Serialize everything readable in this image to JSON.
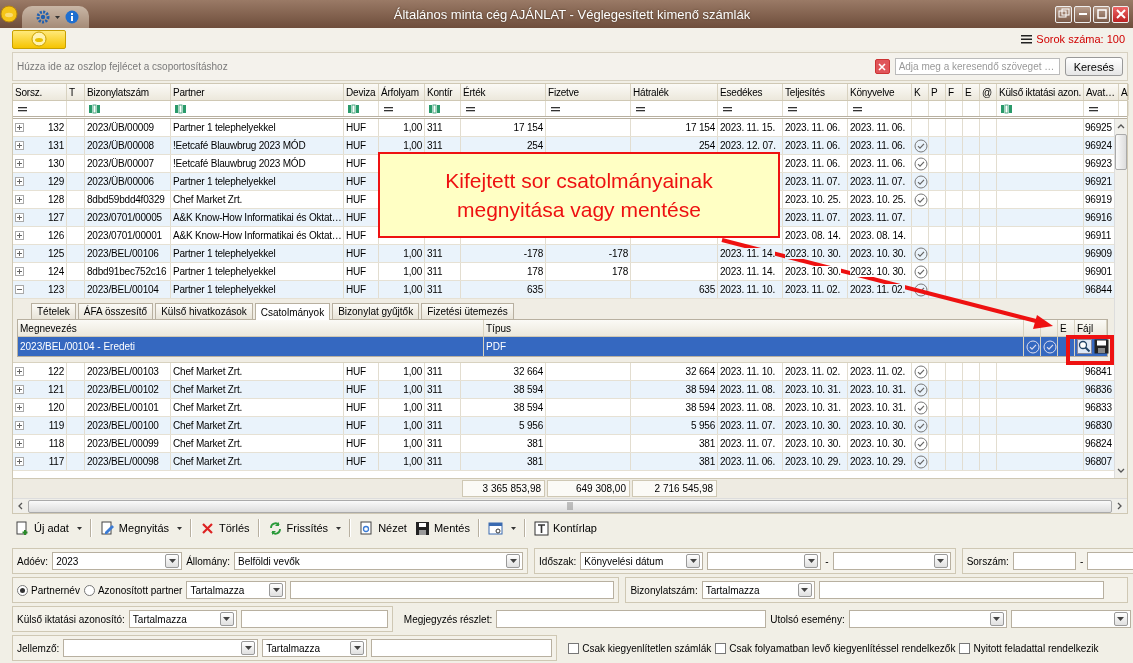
{
  "window": {
    "title": "Általános minta cég AJÁNLAT - Véglegesített kimenő számlák"
  },
  "row_count": "Sorok száma: 100",
  "group_panel": {
    "hint": "Húzza ide az oszlop fejlécet a csoportosításhoz",
    "search": {
      "placeholder": "Adja meg a keresendő szöveget …"
    },
    "search_button": "Keresés"
  },
  "grid": {
    "columns": [
      {
        "label": "Sorsz.",
        "kind": "number"
      },
      {
        "label": "T",
        "kind": "text"
      },
      {
        "label": "Bizonylatszám",
        "kind": "text"
      },
      {
        "label": "Partner",
        "kind": "text"
      },
      {
        "label": "Deviza",
        "kind": "text"
      },
      {
        "label": "Árfolyam",
        "kind": "number"
      },
      {
        "label": "Kontír",
        "kind": "text"
      },
      {
        "label": "Érték",
        "kind": "number"
      },
      {
        "label": "Fizetve",
        "kind": "number"
      },
      {
        "label": "Hátralék",
        "kind": "number"
      },
      {
        "label": "Esedékes",
        "kind": "text"
      },
      {
        "label": "Teljesítés",
        "kind": "text"
      },
      {
        "label": "Könyvelve",
        "kind": "text"
      },
      {
        "label": "K",
        "kind": "check"
      },
      {
        "label": "P",
        "kind": "check"
      },
      {
        "label": "F",
        "kind": "check"
      },
      {
        "label": "E",
        "kind": "check"
      },
      {
        "label": "@",
        "kind": "check"
      },
      {
        "label": "Külső iktatási azon.",
        "kind": "text"
      },
      {
        "label": "Avat…",
        "kind": "text"
      },
      {
        "label": "A"
      }
    ],
    "filter_row": [
      {
        "kind": "equals"
      },
      {
        "kind": "none"
      },
      {
        "kind": "text"
      },
      {
        "kind": "text"
      },
      {
        "kind": "text"
      },
      {
        "kind": "equals"
      },
      {
        "kind": "text"
      },
      {
        "kind": "equals"
      },
      {
        "kind": "equals"
      },
      {
        "kind": "equals"
      },
      {
        "kind": "equals"
      },
      {
        "kind": "equals"
      },
      {
        "kind": "equals"
      },
      {
        "kind": "none"
      },
      {
        "kind": "none"
      },
      {
        "kind": "none"
      },
      {
        "kind": "none"
      },
      {
        "kind": "none"
      },
      {
        "kind": "text"
      },
      {
        "kind": "equals"
      },
      {
        "kind": "none"
      }
    ],
    "rows": [
      {
        "expanded": false,
        "cells": [
          "132",
          null,
          "2023/ÜB/00009",
          "Partner 1 telephelyekkel",
          "HUF",
          "1,00",
          "311",
          "17 154",
          null,
          "17 154",
          "2023. 11. 15.",
          "2023. 11. 06.",
          "2023. 11. 06.",
          false,
          null,
          null,
          null,
          null,
          null,
          "96925"
        ]
      },
      {
        "expanded": false,
        "cells": [
          "131",
          null,
          "2023/ÜB/00008",
          "!Eetcafé Blauwbrug 2023 MÓD",
          "HUF",
          "1,00",
          "311",
          "254",
          null,
          "254",
          "2023. 12. 07.",
          "2023. 11. 06.",
          "2023. 11. 06.",
          true,
          null,
          null,
          null,
          null,
          null,
          "96924"
        ]
      },
      {
        "expanded": false,
        "cells": [
          "130",
          null,
          "2023/ÜB/00007",
          "!Eetcafé Blauwbrug 2023 MÓD",
          "HUF",
          null,
          null,
          null,
          null,
          null,
          null,
          "2023. 11. 06.",
          "2023. 11. 06.",
          true,
          null,
          null,
          null,
          null,
          null,
          "96923"
        ]
      },
      {
        "expanded": false,
        "cells": [
          "129",
          null,
          "2023/ÜB/00006",
          "Partner 1 telephelyekkel",
          "HUF",
          null,
          null,
          null,
          null,
          null,
          null,
          "2023. 11. 07.",
          "2023. 11. 07.",
          true,
          null,
          null,
          null,
          null,
          null,
          "96921"
        ]
      },
      {
        "expanded": false,
        "cells": [
          "128",
          null,
          "8dbd59bdd4f0329",
          "Chef Market Zrt.",
          "HUF",
          null,
          null,
          null,
          null,
          null,
          null,
          "2023. 10. 25.",
          "2023. 10. 25.",
          true,
          null,
          null,
          null,
          null,
          null,
          "96919"
        ]
      },
      {
        "expanded": false,
        "cells": [
          "127",
          null,
          "2023/0701/00005",
          "A&K Know-How Informatikai és Oktat…",
          "HUF",
          null,
          null,
          null,
          null,
          null,
          null,
          "2023. 11. 07.",
          "2023. 11. 07.",
          false,
          null,
          null,
          null,
          null,
          null,
          "96916"
        ]
      },
      {
        "expanded": false,
        "cells": [
          "126",
          null,
          "2023/0701/00001",
          "A&K Know-How Informatikai és Oktat…",
          "HUF",
          null,
          null,
          null,
          null,
          null,
          null,
          "2023. 08. 14.",
          "2023. 08. 14.",
          false,
          null,
          null,
          null,
          null,
          null,
          "96911"
        ]
      },
      {
        "expanded": false,
        "cells": [
          "125",
          null,
          "2023/BEL/00106",
          "Partner 1 telephelyekkel",
          "HUF",
          "1,00",
          "311",
          "-178",
          "-178",
          null,
          "2023. 11. 14.",
          "2023. 10. 30.",
          "2023. 10. 30.",
          true,
          null,
          null,
          null,
          null,
          null,
          "96909"
        ]
      },
      {
        "expanded": false,
        "cells": [
          "124",
          null,
          "8dbd91bec752c16",
          "Partner 1 telephelyekkel",
          "HUF",
          "1,00",
          "311",
          "178",
          "178",
          null,
          "2023. 11. 14.",
          "2023. 10. 30.",
          "2023. 10. 30.",
          true,
          null,
          null,
          null,
          null,
          null,
          "96901"
        ]
      },
      {
        "expanded": true,
        "cells": [
          "123",
          null,
          "2023/BEL/00104",
          "Partner 1 telephelyekkel",
          "HUF",
          "1,00",
          "311",
          "635",
          null,
          "635",
          "2023. 11. 10.",
          "2023. 11. 02.",
          "2023. 11. 02.",
          true,
          null,
          null,
          null,
          null,
          null,
          "96844"
        ]
      },
      {
        "expanded": false,
        "cells": [
          "122",
          null,
          "2023/BEL/00103",
          "Chef Market Zrt.",
          "HUF",
          "1,00",
          "311",
          "32 664",
          null,
          "32 664",
          "2023. 11. 10.",
          "2023. 11. 02.",
          "2023. 11. 02.",
          true,
          null,
          null,
          null,
          null,
          null,
          "96841"
        ]
      },
      {
        "expanded": false,
        "cells": [
          "121",
          null,
          "2023/BEL/00102",
          "Chef Market Zrt.",
          "HUF",
          "1,00",
          "311",
          "38 594",
          null,
          "38 594",
          "2023. 11. 08.",
          "2023. 10. 31.",
          "2023. 10. 31.",
          true,
          null,
          null,
          null,
          null,
          null,
          "96836"
        ]
      },
      {
        "expanded": false,
        "cells": [
          "120",
          null,
          "2023/BEL/00101",
          "Chef Market Zrt.",
          "HUF",
          "1,00",
          "311",
          "38 594",
          null,
          "38 594",
          "2023. 11. 08.",
          "2023. 10. 31.",
          "2023. 10. 31.",
          true,
          null,
          null,
          null,
          null,
          null,
          "96833"
        ]
      },
      {
        "expanded": false,
        "cells": [
          "119",
          null,
          "2023/BEL/00100",
          "Chef Market Zrt.",
          "HUF",
          "1,00",
          "311",
          "5 956",
          null,
          "5 956",
          "2023. 11. 07.",
          "2023. 10. 30.",
          "2023. 10. 30.",
          true,
          null,
          null,
          null,
          null,
          null,
          "96830"
        ]
      },
      {
        "expanded": false,
        "cells": [
          "118",
          null,
          "2023/BEL/00099",
          "Chef Market Zrt.",
          "HUF",
          "1,00",
          "311",
          "381",
          null,
          "381",
          "2023. 11. 07.",
          "2023. 10. 30.",
          "2023. 10. 30.",
          true,
          null,
          null,
          null,
          null,
          null,
          "96824"
        ]
      },
      {
        "expanded": false,
        "cells": [
          "117",
          null,
          "2023/BEL/00098",
          "Chef Market Zrt.",
          "HUF",
          "1,00",
          "311",
          "381",
          null,
          "381",
          "2023. 11. 06.",
          "2023. 10. 29.",
          "2023. 10. 29.",
          true,
          null,
          null,
          null,
          null,
          null,
          "96807"
        ]
      }
    ],
    "detail": {
      "tabs": [
        {
          "label": "Tételek",
          "selected": false
        },
        {
          "label": "ÁFA összesítő",
          "selected": false
        },
        {
          "label": "Külső hivatkozások",
          "selected": false
        },
        {
          "label": "Csatolmányok",
          "selected": true
        },
        {
          "label": "Bizonylat gyűjtők",
          "selected": false
        },
        {
          "label": "Fizetési ütemezés",
          "selected": false
        }
      ],
      "headers": [
        "Megnevezés",
        "Típus",
        "E",
        "Fájl"
      ],
      "rows": [
        {
          "name": "2023/BEL/00104 - Eredeti",
          "type": "PDF",
          "column_3_checked": true,
          "column_4_checked": true,
          "selected": true
        }
      ]
    },
    "totals": [
      "3 365 853,98",
      "649 308,00",
      "2 716 545,98"
    ]
  },
  "toolbar": [
    {
      "label": "Új adat",
      "dropdown": true,
      "separator_before": false
    },
    {
      "label": "Megnyitás",
      "dropdown": true,
      "separator_before": true
    },
    {
      "label": "Törlés",
      "dropdown": false,
      "separator_before": true
    },
    {
      "label": "Frissítés",
      "dropdown": true,
      "separator_before": true
    },
    {
      "label": "Nézet",
      "dropdown": false,
      "separator_before": true
    },
    {
      "label": "Mentés",
      "dropdown": false,
      "separator_before": false
    },
    {
      "dropdown": true,
      "separator_before": true
    },
    {
      "label": "Kontírlap",
      "dropdown": false,
      "separator_before": true
    }
  ],
  "filters": [
    {
      "groups": [
        {
          "framed": true,
          "items": [
            {
              "kind": "label",
              "text": "Adóév:"
            },
            {
              "kind": "combo",
              "value": "2023"
            },
            {
              "kind": "label",
              "text": "Állomány:"
            },
            {
              "kind": "combo",
              "value": "Belföldi vevők"
            }
          ]
        },
        {
          "framed": true,
          "items": [
            {
              "kind": "label",
              "text": "Időszak:"
            },
            {
              "kind": "combo",
              "value": "Könyvelési dátum"
            },
            {
              "kind": "combo"
            },
            {
              "kind": "label",
              "text": "-"
            },
            {
              "kind": "combo"
            }
          ]
        },
        {
          "framed": true,
          "items": [
            {
              "kind": "label",
              "text": "Sorszám:"
            },
            {
              "kind": "input"
            },
            {
              "kind": "label",
              "text": "-"
            },
            {
              "kind": "input"
            }
          ]
        }
      ]
    },
    {
      "groups": [
        {
          "framed": true,
          "items": [
            {
              "kind": "radio",
              "text": "Partnernév",
              "selected": true
            },
            {
              "kind": "radio",
              "text": "Azonosított partner",
              "selected": false
            },
            {
              "kind": "combo",
              "value": "Tartalmazza"
            },
            {
              "kind": "input"
            }
          ]
        },
        {
          "framed": true,
          "items": [
            {
              "kind": "label",
              "text": "Bizonylatszám:"
            },
            {
              "kind": "combo",
              "value": "Tartalmazza"
            },
            {
              "kind": "input"
            }
          ]
        }
      ]
    },
    {
      "groups": [
        {
          "framed": true,
          "items": [
            {
              "kind": "label",
              "text": "Külső iktatási azonosító:"
            },
            {
              "kind": "combo",
              "value": "Tartalmazza"
            },
            {
              "kind": "input"
            }
          ]
        },
        {
          "framed": false,
          "items": [
            {
              "kind": "label",
              "text": "Megjegyzés részlet:"
            },
            {
              "kind": "input"
            },
            {
              "kind": "label",
              "text": "Utolsó esemény:"
            },
            {
              "kind": "combo"
            },
            {
              "kind": "combo"
            }
          ]
        }
      ]
    },
    {
      "groups": [
        {
          "framed": true,
          "items": [
            {
              "kind": "label",
              "text": "Jellemző:"
            },
            {
              "kind": "combo"
            },
            {
              "kind": "combo",
              "value": "Tartalmazza"
            },
            {
              "kind": "input"
            }
          ]
        },
        {
          "framed": false,
          "items": [
            {
              "kind": "checkbox",
              "text": "Csak kiegyenlítetlen számlák",
              "checked": false
            },
            {
              "kind": "checkbox",
              "text": "Csak folyamatban levő kiegyenlítéssel rendelkezők",
              "checked": false
            },
            {
              "kind": "checkbox",
              "text": "Nyitott feladattal rendelkezik",
              "checked": false
            }
          ]
        }
      ]
    }
  ],
  "callout": {
    "text": "Kifejtett sor csatolmányainak megnyitása vagy mentése"
  }
}
